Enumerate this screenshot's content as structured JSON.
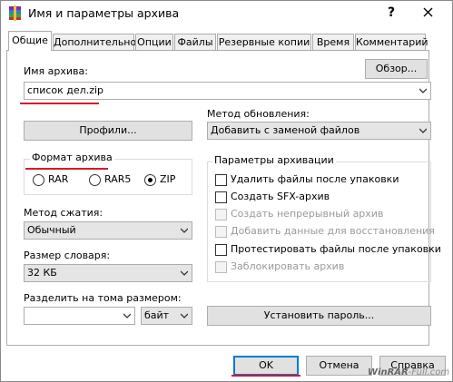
{
  "window": {
    "title": "Имя и параметры архива",
    "help_label": "?"
  },
  "tabs": [
    {
      "label": "Общие",
      "active": true
    },
    {
      "label": "Дополнительно"
    },
    {
      "label": "Опции"
    },
    {
      "label": "Файлы"
    },
    {
      "label": "Резервные копии"
    },
    {
      "label": "Время"
    },
    {
      "label": "Комментарий"
    }
  ],
  "archive_name": {
    "label": "Имя архива:",
    "browse_label": "Обзор...",
    "value": "список дел.zip"
  },
  "profiles_label": "Профили...",
  "update_method": {
    "label": "Метод обновления:",
    "value": "Добавить с заменой файлов"
  },
  "archive_format": {
    "label": "Формат архива",
    "options": [
      "RAR",
      "RAR5",
      "ZIP"
    ],
    "selected": "ZIP"
  },
  "compression": {
    "label": "Метод сжатия:",
    "value": "Обычный"
  },
  "dictionary": {
    "label": "Размер словаря:",
    "value": "32 КБ"
  },
  "split": {
    "label": "Разделить на тома размером:",
    "value": "",
    "unit": "байт"
  },
  "archiving_options": {
    "label": "Параметры архивации",
    "items": [
      {
        "label": "Удалить файлы после упаковки",
        "checked": false,
        "enabled": true
      },
      {
        "label": "Создать SFX-архив",
        "checked": false,
        "enabled": true
      },
      {
        "label": "Создать непрерывный архив",
        "checked": false,
        "enabled": false
      },
      {
        "label": "Добавить данные для восстановления",
        "checked": false,
        "enabled": false
      },
      {
        "label": "Протестировать файлы после упаковки",
        "checked": false,
        "enabled": true
      },
      {
        "label": "Заблокировать архив",
        "checked": false,
        "enabled": false
      }
    ]
  },
  "set_password_label": "Установить пароль...",
  "buttons": {
    "ok": "OK",
    "cancel": "Отмена",
    "help": "Справка"
  },
  "watermark": {
    "brand": "WinRAR",
    "suffix": "-Full.com"
  },
  "colors": {
    "highlight_underline": "#d7192a",
    "focus_border": "#0078d7"
  }
}
